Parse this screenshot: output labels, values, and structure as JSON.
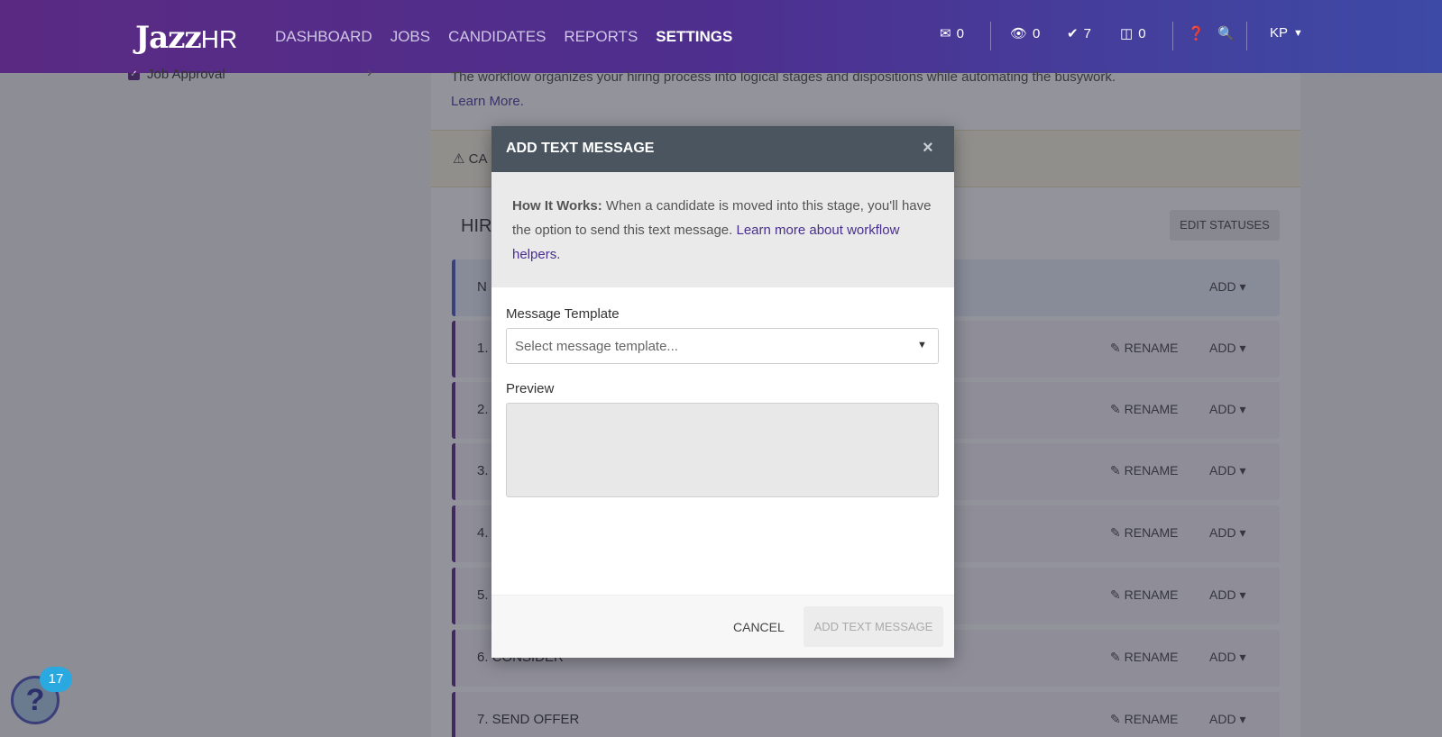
{
  "nav": {
    "logo_main": "Jazz",
    "logo_hr": "HR",
    "items": [
      {
        "label": "DASHBOARD",
        "active": false
      },
      {
        "label": "JOBS",
        "active": false
      },
      {
        "label": "CANDIDATES",
        "active": false
      },
      {
        "label": "REPORTS",
        "active": false
      },
      {
        "label": "SETTINGS",
        "active": true
      }
    ],
    "counters": {
      "messages": "0",
      "views": "0",
      "approvals": "7",
      "inbox": "0"
    },
    "user_initials": "KP"
  },
  "sidebar": {
    "job_approval": "Job Approval"
  },
  "page": {
    "intro": "The workflow organizes your hiring process into logical stages and dispositions while automating the busywork.",
    "learn_more": "Learn More.",
    "warning_prefix": "CA",
    "hiring_title": "HIR",
    "edit_statuses": "EDIT STATUSES",
    "rename_label": "RENAME",
    "add_label": "ADD",
    "stages": [
      {
        "label": "N"
      },
      {
        "label": "1."
      },
      {
        "label": "2."
      },
      {
        "label": "3."
      },
      {
        "label": "4."
      },
      {
        "label": "5."
      },
      {
        "label": "6. CONSIDER"
      },
      {
        "label": "7. SEND OFFER"
      }
    ]
  },
  "modal": {
    "title": "ADD TEXT MESSAGE",
    "close": "×",
    "how_it_works_label": "How It Works:",
    "how_it_works_text": "When a candidate is moved into this stage, you'll have the option to send this text message.",
    "learn_link": "Learn more about workflow helpers.",
    "template_label": "Message Template",
    "template_placeholder": "Select message template...",
    "preview_label": "Preview",
    "cancel": "CANCEL",
    "submit": "ADD TEXT MESSAGE"
  },
  "help": {
    "badge": "17",
    "glyph": "?"
  },
  "colors": {
    "brand_purple": "#5a2a82",
    "nav_blue": "#3d4aa6",
    "modal_header": "#4a5560",
    "link": "#4a2f8f",
    "badge": "#2aa8e0"
  }
}
